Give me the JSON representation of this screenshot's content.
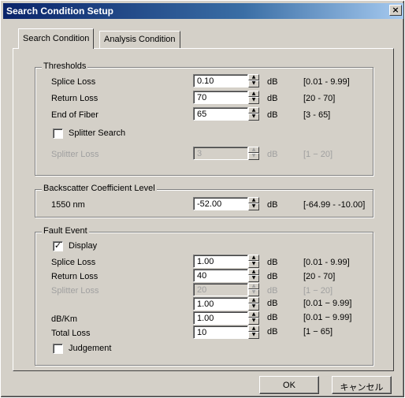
{
  "window": {
    "title": "Search Condition Setup",
    "close_glyph": "×"
  },
  "tabs": [
    {
      "label": "Search Condition"
    },
    {
      "label": "Analysis Condition"
    }
  ],
  "thresholds": {
    "title": "Thresholds",
    "rows": [
      {
        "label": "Splice Loss",
        "value": "0.10",
        "unit": "dB",
        "range": "[0.01 - 9.99]"
      },
      {
        "label": "Return Loss",
        "value": "70",
        "unit": "dB",
        "range": "[20 - 70]"
      },
      {
        "label": "End of Fiber",
        "value": "65",
        "unit": "dB",
        "range": "[3 - 65]"
      }
    ],
    "splitter_search": {
      "label": "Splitter Search",
      "checked": false
    },
    "splitter_loss": {
      "label": "Splitter Loss",
      "value": "3",
      "unit": "dB",
      "range": "[1 − 20]"
    }
  },
  "backscatter": {
    "title": "Backscatter Coefficient Level",
    "label": "1550 nm",
    "value": "-52.00",
    "unit": "dB",
    "range": "[-64.99 - -10.00]"
  },
  "fault_event": {
    "title": "Fault Event",
    "display": {
      "label": "Display",
      "checked": true,
      "mark": "✓"
    },
    "rows": [
      {
        "label": "Splice Loss",
        "value": "1.00",
        "unit": "dB",
        "range": "[0.01 - 9.99]",
        "disabled": false
      },
      {
        "label": "Return Loss",
        "value": "40",
        "unit": "dB",
        "range": "[20 - 70]",
        "disabled": false
      },
      {
        "label": "Splitter Loss",
        "value": "20",
        "unit": "dB",
        "range": "[1 − 20]",
        "disabled": true
      },
      {
        "label": "",
        "value": "1.00",
        "unit": "dB",
        "range": "[0.01 − 9.99]",
        "disabled": false
      },
      {
        "label": "dB/Km",
        "value": "1.00",
        "unit": "dB",
        "range": "[0.01 − 9.99]",
        "disabled": false
      },
      {
        "label": "Total Loss",
        "value": "10",
        "unit": "dB",
        "range": "[1 − 65]",
        "disabled": false
      }
    ],
    "judgement": {
      "label": "Judgement",
      "checked": false
    }
  },
  "buttons": {
    "ok": "OK",
    "cancel": "キャンセル"
  },
  "spin_glyphs": {
    "up": "▲",
    "down": "▼"
  }
}
